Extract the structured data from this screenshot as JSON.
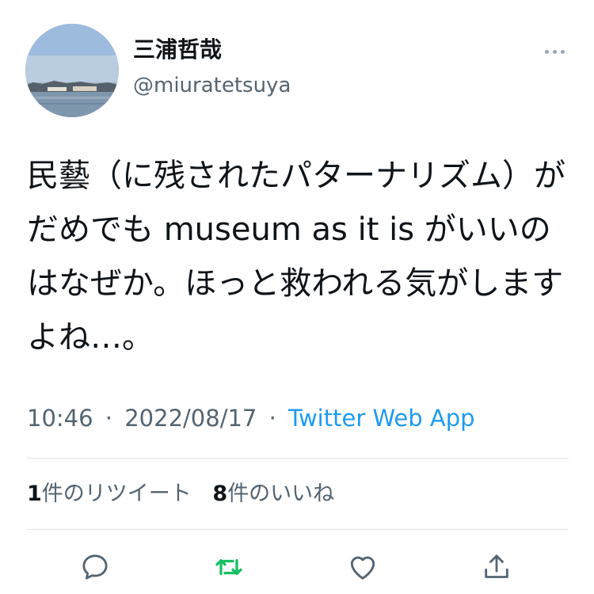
{
  "author": {
    "display_name": "三浦哲哉",
    "username": "@miuratetsuya"
  },
  "tweet": {
    "text": "民藝（に残されたパターナリズム）がだめでも museum as it is がいいのはなぜか。ほっと救われる気がしますよね…。",
    "time": "10:46",
    "date": "2022/08/17",
    "separator": "·",
    "source": "Twitter Web App"
  },
  "stats": {
    "retweets_count": "1",
    "retweets_label": "件のリツイート",
    "likes_count": "8",
    "likes_label": "件のいいね"
  },
  "colors": {
    "link": "#1d9bf0",
    "secondary_text": "#536471",
    "retweet_icon": "#17bf63",
    "icon": "#536471"
  },
  "actions": {
    "reply_icon": "comment-icon",
    "retweet_icon": "retweet-icon",
    "like_icon": "heart-icon",
    "share_icon": "share-icon"
  }
}
